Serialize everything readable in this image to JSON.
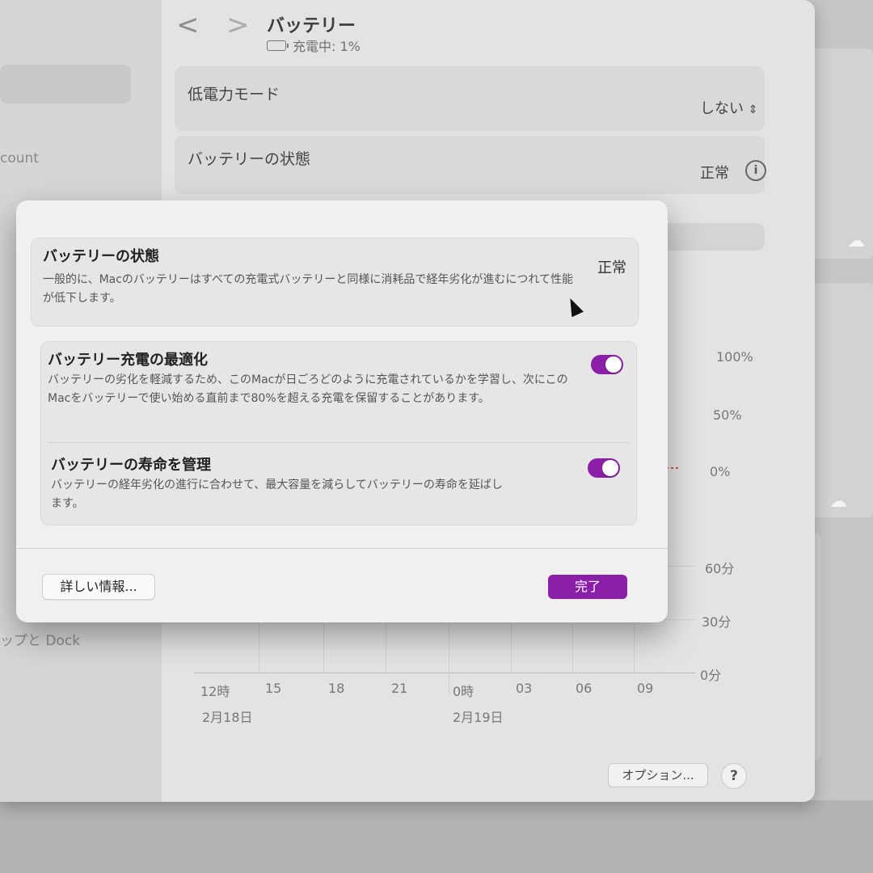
{
  "window": {
    "title": "バッテリー",
    "subtitle": "充電中: 1%",
    "nav": {
      "back": "<",
      "forward": ">"
    }
  },
  "sidebar": {
    "fragment_account": "count",
    "fragment_dock": "ップと Dock"
  },
  "settings": {
    "low_power_label": "低電力モード",
    "low_power_value": "しない",
    "health_label": "バッテリーの状態",
    "health_value": "正常"
  },
  "chart": {
    "y_ticks_level": [
      "100%",
      "50%",
      "0%"
    ],
    "y_ticks_usage": [
      "60分",
      "30分",
      "0分"
    ],
    "x_ticks": [
      "12時",
      "15",
      "18",
      "21",
      "0時",
      "03",
      "06",
      "09"
    ],
    "dates": [
      "2月18日",
      "2月19日"
    ],
    "partial_tick": "9"
  },
  "footer": {
    "options_label": "オプション...",
    "help_label": "?"
  },
  "sheet": {
    "health": {
      "title": "バッテリーの状態",
      "value": "正常",
      "description": "一般的に、Macのバッテリーはすべての充電式バッテリーと同様に消耗品で経年劣化が進むにつれて性能が低下します。"
    },
    "optimized_charging": {
      "title": "バッテリー充電の最適化",
      "enabled": true,
      "description": "バッテリーの劣化を軽減するため、このMacが日ごろどのように充電されているかを学習し、次にこのMacをバッテリーで使い始める直前まで80%を超える充電を保留することがあります。"
    },
    "lifespan": {
      "title": "バッテリーの寿命を管理",
      "enabled": true,
      "description": "バッテリーの経年劣化の進行に合わせて、最大容量を減らしてバッテリーの寿命を延ばします。"
    },
    "more_info_label": "詳しい情報...",
    "done_label": "完了"
  },
  "colors": {
    "accent": "#8a1fa8"
  }
}
